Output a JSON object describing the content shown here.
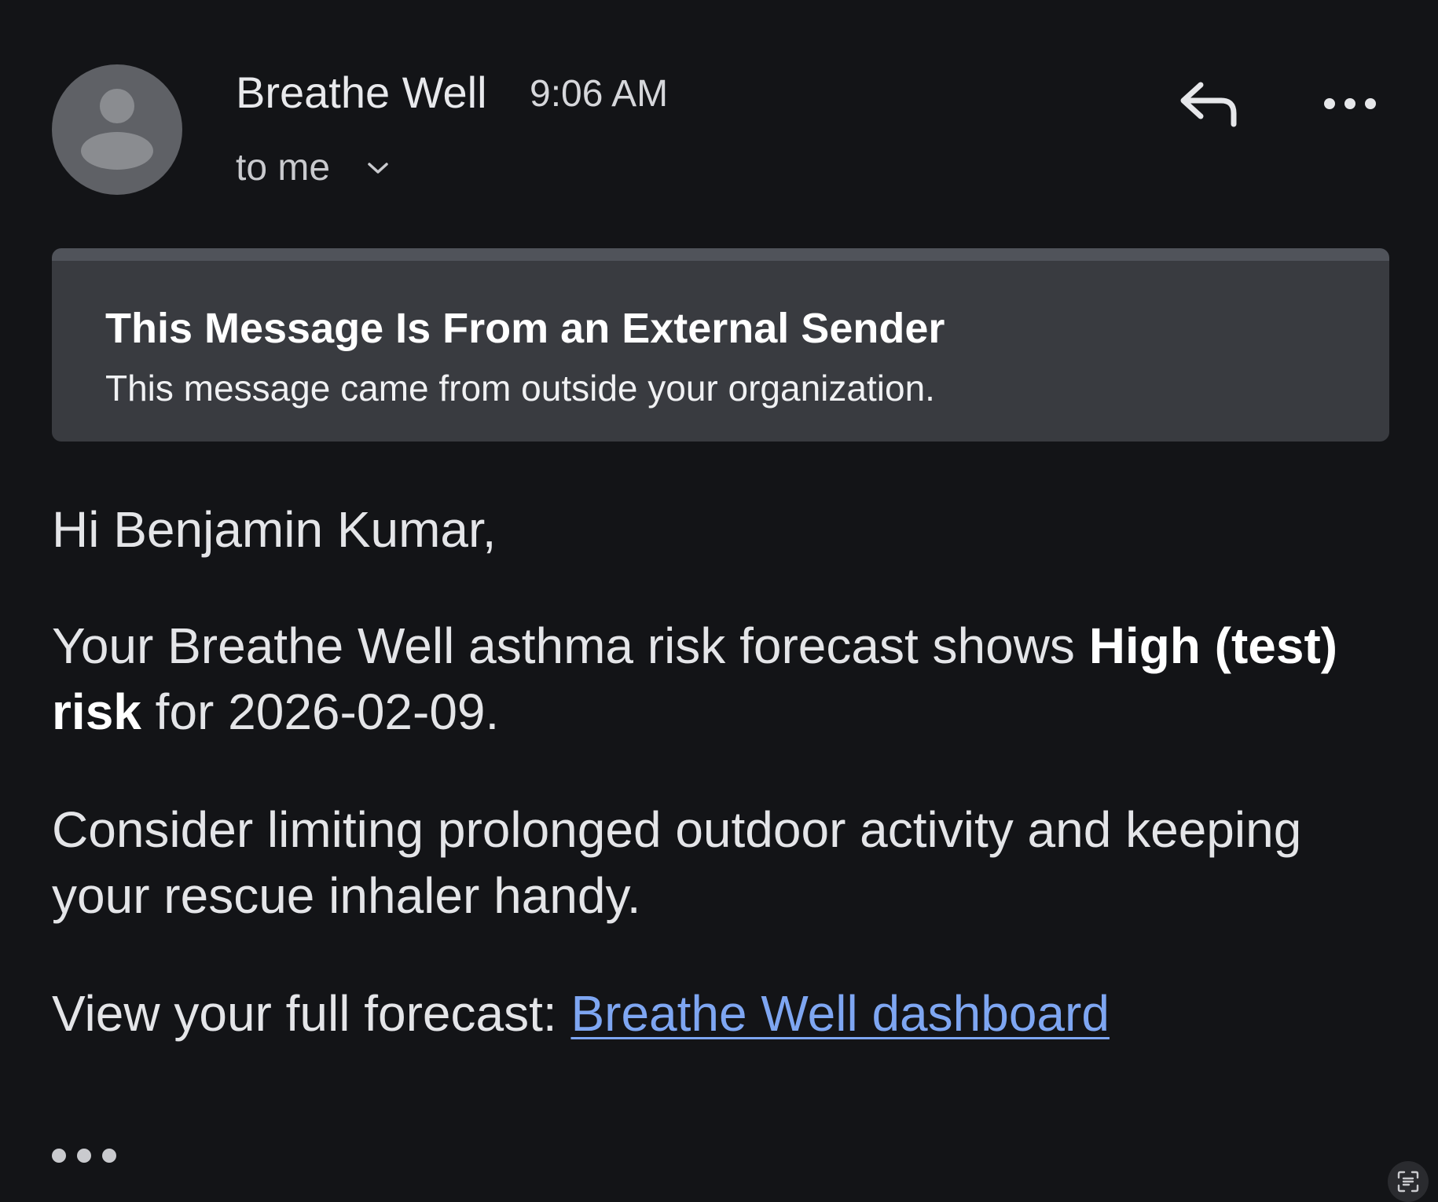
{
  "header": {
    "sender_name": "Breathe Well",
    "time": "9:06 AM",
    "recipient_label": "to me",
    "icons": {
      "avatar": "person-avatar-icon",
      "recipient_toggle": "chevron-down-icon",
      "reply": "reply-arrow-icon",
      "more": "more-horizontal-icon"
    }
  },
  "banner": {
    "title": "This Message Is From an External Sender",
    "text": "This message came from outside your organization."
  },
  "message": {
    "greeting": "Hi Benjamin Kumar,",
    "risk": {
      "prefix": "Your Breathe Well asthma risk forecast shows ",
      "level": "High (test) risk",
      "suffix": " for 2026-02-09."
    },
    "advice": "Consider limiting prolonged outdoor activity and keeping your rescue inhaler handy.",
    "link": {
      "prefix": "View your full forecast: ",
      "label": "Breathe Well dashboard"
    }
  },
  "footer": {
    "show_trimmed_icon": "ellipsis-icon",
    "live_text_icon": "text-scan-icon"
  },
  "colors": {
    "background": "#131417",
    "banner_background": "#393b40",
    "banner_top_bar": "#50535a",
    "link": "#7ea6f2",
    "avatar": "#5f6166"
  }
}
